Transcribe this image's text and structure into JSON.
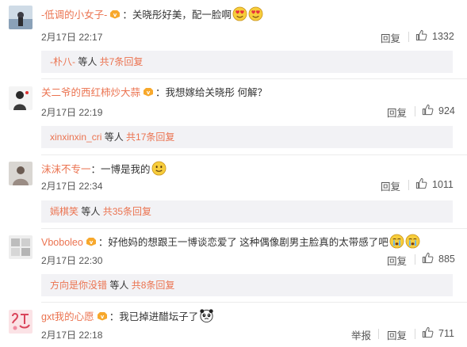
{
  "comments": [
    {
      "user": "-低调的小女子-",
      "text": "：关晓彤好美，配一脸啊",
      "emojis": [
        "heart-eyes-emoji",
        "heart-eyes-emoji"
      ],
      "time": "2月17日 22:17",
      "reply_label": "回复",
      "likes": "1332",
      "thread": {
        "user": "-朴八-",
        "mid": " 等人 ",
        "total": "共7条回复"
      }
    },
    {
      "user": "关二爷的西红柿炒大蒜",
      "text": "：我想嫁给关晓彤 何解？",
      "emojis": [],
      "time": "2月17日 22:19",
      "reply_label": "回复",
      "likes": "924",
      "thread": {
        "user": "xinxinxin_cri",
        "mid": " 等人 ",
        "total": "共17条回复"
      }
    },
    {
      "user": "沫沫不专一",
      "text": "：一博是我的",
      "emojis": [
        "smile-emoji"
      ],
      "time": "2月17日 22:34",
      "reply_label": "回复",
      "likes": "1011",
      "thread": {
        "user": "嫣棋笑",
        "mid": " 等人 ",
        "total": "共35条回复"
      }
    },
    {
      "user": "Vboboleo",
      "text": "：好他妈的想跟王一博谈恋爱了 这种偶像剧男主脸真的太带感了吧",
      "emojis": [
        "crying-emoji",
        "crying-emoji"
      ],
      "time": "2月17日 22:30",
      "reply_label": "回复",
      "likes": "885",
      "thread": {
        "user": "方向是你没错",
        "mid": " 等人 ",
        "total": "共8条回复"
      }
    },
    {
      "user": "gxt我的心愿",
      "text": "：我已掉进醋坛子了",
      "emojis": [
        "panda-emoji"
      ],
      "time": "2月17日 22:18",
      "report_label": "举报",
      "reply_label": "回复",
      "likes": "711"
    }
  ],
  "colors": {
    "username": "#eb7350",
    "thread_bg": "#f2f2f5",
    "text": "#333333",
    "meta": "#555555"
  }
}
